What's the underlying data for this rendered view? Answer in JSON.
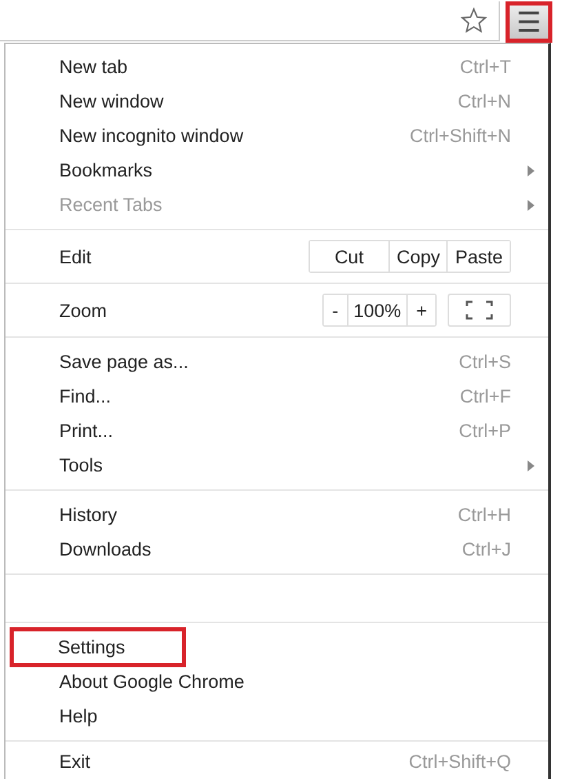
{
  "toolbar": {
    "menu_button": {
      "label": "☰",
      "highlighted": true
    }
  },
  "menu": {
    "sections": [
      {
        "kind": "items",
        "items": [
          {
            "label": "New tab",
            "shortcut": "Ctrl+T",
            "submenu": false,
            "disabled": false,
            "highlighted": false
          },
          {
            "label": "New window",
            "shortcut": "Ctrl+N",
            "submenu": false,
            "disabled": false,
            "highlighted": false
          },
          {
            "label": "New incognito window",
            "shortcut": "Ctrl+Shift+N",
            "submenu": false,
            "disabled": false,
            "highlighted": false
          },
          {
            "label": "Bookmarks",
            "submenu": true,
            "disabled": false,
            "highlighted": false
          },
          {
            "label": "Recent Tabs",
            "submenu": true,
            "disabled": true,
            "highlighted": false
          }
        ]
      },
      {
        "kind": "edit",
        "label": "Edit",
        "buttons": [
          "Cut",
          "Copy",
          "Paste"
        ]
      },
      {
        "kind": "zoom",
        "label": "Zoom",
        "minus": "-",
        "value": "100%",
        "plus": "+"
      },
      {
        "kind": "items",
        "items": [
          {
            "label": "Save page as...",
            "shortcut": "Ctrl+S",
            "submenu": false,
            "disabled": false,
            "highlighted": false
          },
          {
            "label": "Find...",
            "shortcut": "Ctrl+F",
            "submenu": false,
            "disabled": false,
            "highlighted": false
          },
          {
            "label": "Print...",
            "shortcut": "Ctrl+P",
            "submenu": false,
            "disabled": false,
            "highlighted": false
          },
          {
            "label": "Tools",
            "submenu": true,
            "disabled": false,
            "highlighted": false
          }
        ]
      },
      {
        "kind": "items",
        "items": [
          {
            "label": "History",
            "shortcut": "Ctrl+H",
            "submenu": false,
            "disabled": false,
            "highlighted": false
          },
          {
            "label": "Downloads",
            "shortcut": "Ctrl+J",
            "submenu": false,
            "disabled": false,
            "highlighted": false
          }
        ]
      },
      {
        "kind": "empty"
      },
      {
        "kind": "items",
        "items": [
          {
            "label": "Settings",
            "submenu": false,
            "disabled": false,
            "highlighted": true
          },
          {
            "label": "About Google Chrome",
            "submenu": false,
            "disabled": false,
            "highlighted": false
          },
          {
            "label": "Help",
            "submenu": false,
            "disabled": false,
            "highlighted": false
          }
        ]
      },
      {
        "kind": "items",
        "items": [
          {
            "label": "Exit",
            "shortcut": "Ctrl+Shift+Q",
            "submenu": false,
            "disabled": false,
            "highlighted": false
          }
        ]
      }
    ]
  }
}
